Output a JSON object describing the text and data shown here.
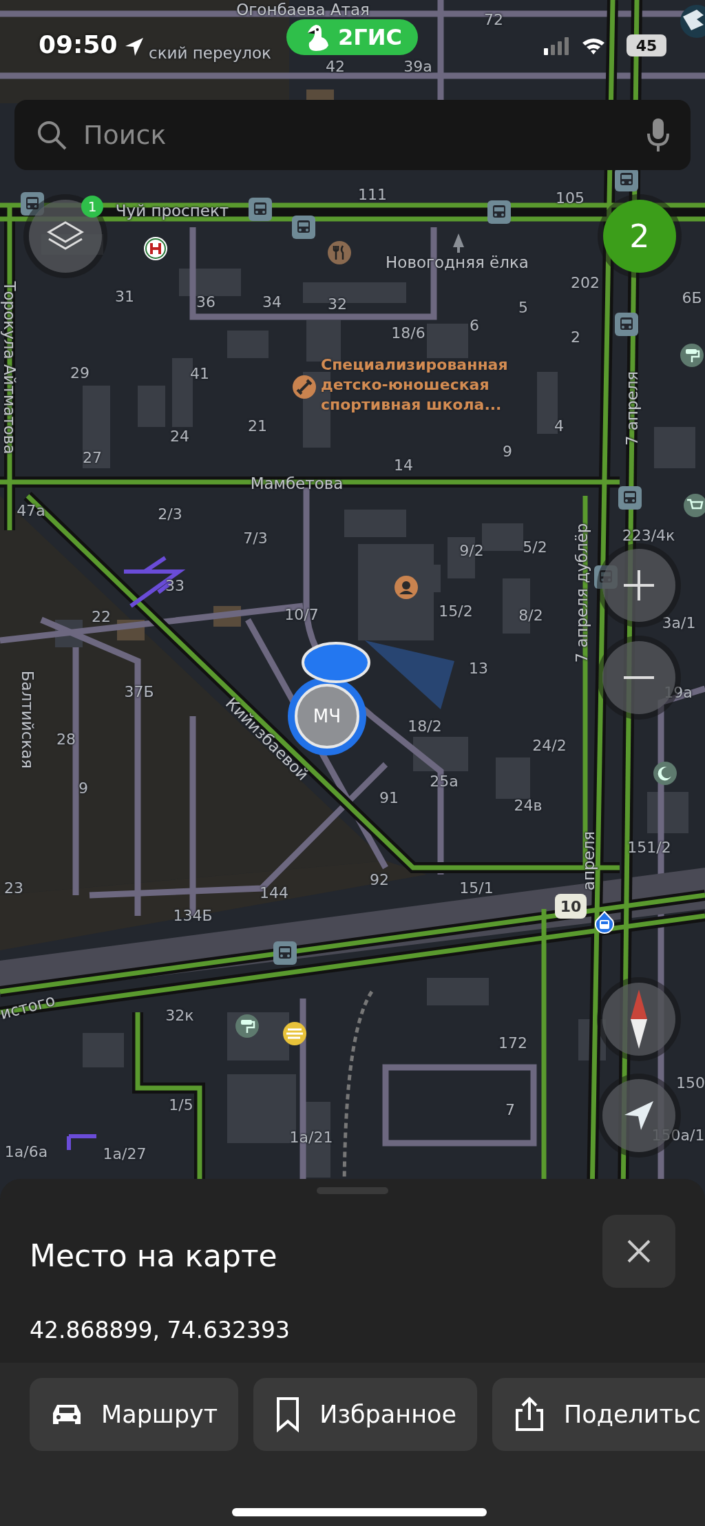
{
  "status_bar": {
    "time": "09:50",
    "battery": "45"
  },
  "logo": {
    "text": "2ГИС"
  },
  "search": {
    "placeholder": "Поиск"
  },
  "map": {
    "street_labels": [
      "Огонбаева Атая",
      "ский переулок",
      "Чуй проспект",
      "Мамбетова",
      "Торокула Айтматова",
      "Балтийская",
      "Кийизбаевой",
      "7 апреля",
      "7 апреля дублёр",
      "апреля",
      "истого",
      "Новогодняя ёлка"
    ],
    "house_numbers": [
      "72",
      "42",
      "39а",
      "111",
      "105",
      "202",
      "31",
      "36",
      "34",
      "32",
      "5",
      "6",
      "18/6",
      "2",
      "6Б",
      "29",
      "41",
      "21",
      "24",
      "4",
      "9",
      "27",
      "14",
      "47а",
      "2/3",
      "7/3",
      "9/2",
      "5/2",
      "223/4к",
      "33",
      "22",
      "10/7",
      "15/2",
      "8/2",
      "3а/1",
      "13",
      "19а",
      "37Б",
      "28",
      "18/2",
      "24/2",
      "9",
      "91",
      "25а",
      "24в",
      "151/2",
      "23",
      "144",
      "92",
      "15/1",
      "134Б",
      "32к",
      "172",
      "150",
      "1/5",
      "7",
      "1а/21",
      "150а/1",
      "1а/6а",
      "1а/27"
    ],
    "poi_label": "Специализированная детско-юношеская спортивная школа...",
    "layers_badge": "1",
    "traffic_score": "2",
    "route_badge": "10",
    "marker_text": "МЧ"
  },
  "place_card": {
    "title": "Место на карте",
    "coordinates": "42.868899, 74.632393",
    "actions": [
      {
        "kind": "route",
        "label": "Маршрут"
      },
      {
        "kind": "favorite",
        "label": "Избранное"
      },
      {
        "kind": "share",
        "label": "Поделитьс"
      }
    ]
  }
}
